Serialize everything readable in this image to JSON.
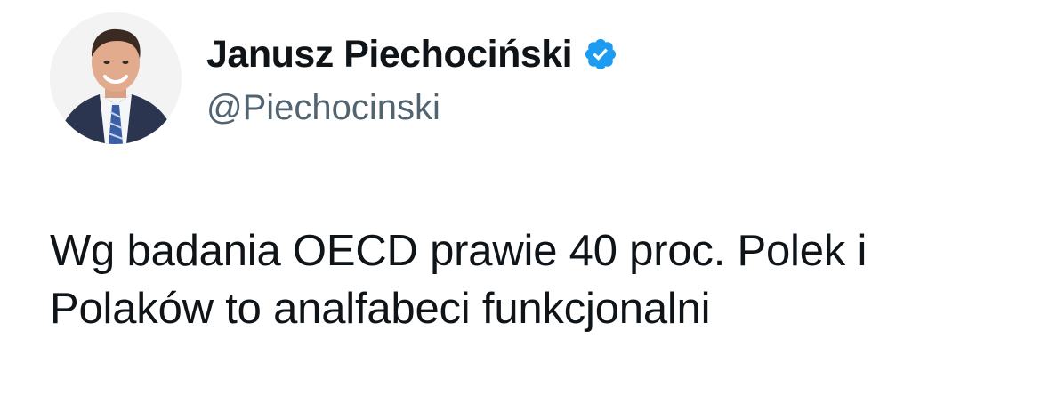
{
  "author": {
    "display_name": "Janusz Piechociński",
    "handle": "@Piechocinski",
    "verified_icon": "verified-badge-icon",
    "avatar_icon": "avatar-photo"
  },
  "tweet": {
    "text_lines": [
      "Wg badania OECD prawie 40 proc. Polek i",
      "Polaków to analfabeci funkcjonalni"
    ]
  },
  "colors": {
    "text_primary": "#0f1419",
    "text_secondary": "#536471",
    "verified_blue": "#1d9bf0",
    "background": "#ffffff"
  }
}
